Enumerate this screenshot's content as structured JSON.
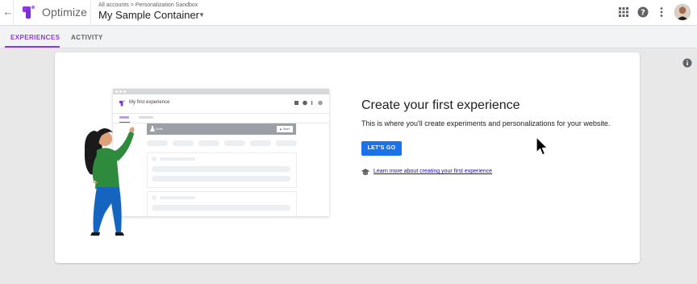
{
  "header": {
    "product_name": "Optimize",
    "breadcrumb": [
      "All accounts",
      "Personalization Sandbox"
    ],
    "breadcrumb_sep": ">",
    "container_name": "My Sample Container",
    "brand_color": "#9334e6",
    "icons": [
      "back-arrow-icon",
      "apps-grid-icon",
      "help-icon",
      "more-vert-icon"
    ]
  },
  "tabs": [
    {
      "label": "EXPERIENCES",
      "active": true
    },
    {
      "label": "ACTIVITY",
      "active": false
    }
  ],
  "illustration": {
    "title": "My first experience",
    "status": "Draft",
    "start_label": "Start"
  },
  "empty_state": {
    "title": "Create your first experience",
    "description": "This is where you'll create experiments and personalizations for your website.",
    "cta_label": "LET'S GO",
    "learn_link": "Learn more about creating your first experience",
    "cta_color": "#1a73e8"
  }
}
